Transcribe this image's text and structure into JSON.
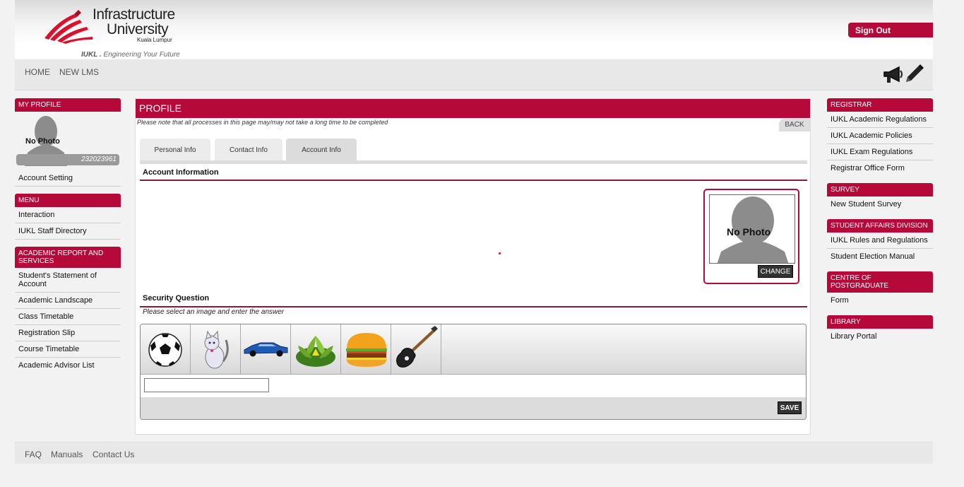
{
  "header": {
    "logo_title_line1": "Infrastructure",
    "logo_title_line2": "University",
    "logo_subtitle": "Kuala Lumpur",
    "tagline_brand": "IUKL .",
    "tagline_text": "Engineering Your Future",
    "signout_label": "Sign Out",
    "brand_color": "#b5093a"
  },
  "nav": {
    "items": [
      "HOME",
      "NEW LMS"
    ],
    "icons": [
      "megaphone-icon",
      "pencil-icon"
    ]
  },
  "left_sidebar": {
    "profile_head": "MY PROFILE",
    "no_photo": "No Photo",
    "student_id": "232023961",
    "account_setting": "Account Setting",
    "menu_head": "MENU",
    "menu_items": [
      "Interaction",
      "IUKL Staff Directory"
    ],
    "academic_head": "ACADEMIC REPORT AND SERVICES",
    "academic_items": [
      "Student's Statement of Account",
      "Academic Landscape",
      "Class Timetable",
      "Registration Slip",
      "Course Timetable",
      "Academic Advisor List"
    ]
  },
  "main": {
    "title": "PROFILE",
    "note": "Please note that all processes in this page may/may not take a long time to be completed",
    "back_label": "BACK",
    "tabs": [
      "Personal Info",
      "Contact Info",
      "Account Info"
    ],
    "active_tab": "Account Info",
    "account_heading": "Account Information",
    "no_photo": "No Photo",
    "change_label": "CHANGE",
    "security_heading": "Security Question",
    "security_note": "Please select an image and enter the answer",
    "security_images": [
      "soccer-ball-icon",
      "cat-icon",
      "car-icon",
      "plant-icon",
      "burger-icon",
      "guitar-icon"
    ],
    "answer_value": "",
    "save_label": "SAVE"
  },
  "right_sidebar": {
    "registrar_head": "REGISTRAR",
    "registrar_items": [
      "IUKL Academic Regulations",
      "IUKL Academic Policies",
      "IUKL Exam Regulations",
      "Registrar Office Form"
    ],
    "survey_head": "SURVEY",
    "survey_items": [
      "New Student Survey"
    ],
    "affairs_head": "STUDENT AFFAIRS DIVISION",
    "affairs_items": [
      "IUKL Rules and Regulations",
      "Student Election Manual"
    ],
    "postgrad_head": "CENTRE OF POSTGRADUATE",
    "postgrad_items": [
      "Form"
    ],
    "library_head": "LIBRARY",
    "library_items": [
      "Library Portal"
    ]
  },
  "footer": {
    "links": [
      "FAQ",
      "Manuals",
      "Contact Us"
    ]
  }
}
